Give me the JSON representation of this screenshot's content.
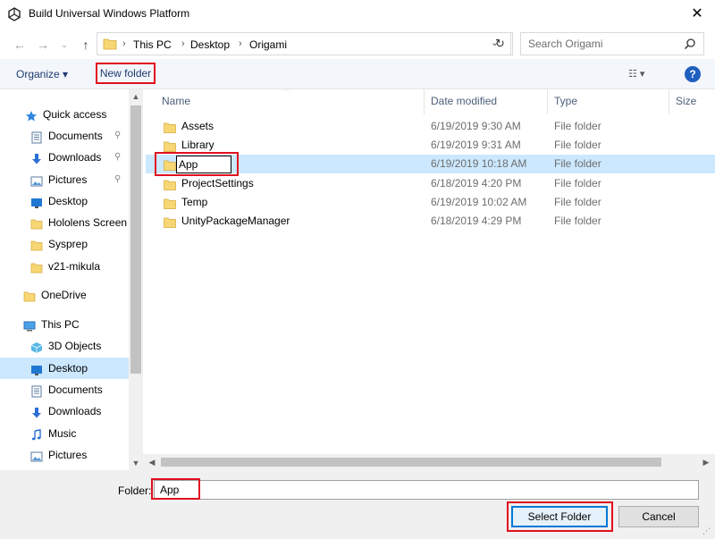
{
  "window": {
    "title": "Build Universal Windows Platform",
    "close_label": "✕"
  },
  "address": {
    "crumbs": [
      "This PC",
      "Desktop",
      "Origami"
    ],
    "separator": "›",
    "history_dropdown": "⌄",
    "refresh_label": "↻"
  },
  "search": {
    "placeholder": "Search Origami"
  },
  "toolbar": {
    "organize_label": "Organize ▾",
    "new_folder_label": "New folder",
    "view_label": "☷ ▾",
    "help_label": "?"
  },
  "nav": {
    "items": [
      {
        "label": "Quick access",
        "icon": "star-icon",
        "pinned": false
      },
      {
        "label": "Documents",
        "icon": "documents-icon",
        "pinned": true
      },
      {
        "label": "Downloads",
        "icon": "downloads-icon",
        "pinned": true
      },
      {
        "label": "Pictures",
        "icon": "pictures-icon",
        "pinned": true
      },
      {
        "label": "Desktop",
        "icon": "desktop-icon",
        "pinned": false
      },
      {
        "label": "Hololens Screen",
        "icon": "folder-icon",
        "pinned": false
      },
      {
        "label": "Sysprep",
        "icon": "folder-icon",
        "pinned": false
      },
      {
        "label": "v21-mikula",
        "icon": "folder-icon",
        "pinned": false
      },
      {
        "label": "OneDrive",
        "icon": "folder-icon",
        "pinned": false
      },
      {
        "label": "This PC",
        "icon": "computer-icon",
        "pinned": false
      },
      {
        "label": "3D Objects",
        "icon": "cube-icon",
        "pinned": false
      },
      {
        "label": "Desktop",
        "icon": "desktop-icon",
        "pinned": false,
        "selected": true
      },
      {
        "label": "Documents",
        "icon": "documents-icon",
        "pinned": false
      },
      {
        "label": "Downloads",
        "icon": "downloads-icon",
        "pinned": false
      },
      {
        "label": "Music",
        "icon": "music-icon",
        "pinned": false
      },
      {
        "label": "Pictures",
        "icon": "pictures-icon",
        "pinned": false
      }
    ],
    "pin_glyph": "📌"
  },
  "filelist": {
    "columns": [
      "Name",
      "Date modified",
      "Type",
      "Size"
    ],
    "sort_glyph": "^",
    "rows": [
      {
        "name": "Assets",
        "date": "6/19/2019 9:30 AM",
        "type": "File folder"
      },
      {
        "name": "Library",
        "date": "6/19/2019 9:31 AM",
        "type": "File folder"
      },
      {
        "name": "App",
        "date": "6/19/2019 10:18 AM",
        "type": "File folder",
        "editing": true
      },
      {
        "name": "ProjectSettings",
        "date": "6/18/2019 4:20 PM",
        "type": "File folder"
      },
      {
        "name": "Temp",
        "date": "6/19/2019 10:02 AM",
        "type": "File folder"
      },
      {
        "name": "UnityPackageManager",
        "date": "6/18/2019 4:29 PM",
        "type": "File folder"
      }
    ]
  },
  "bottom": {
    "folder_label": "Folder:",
    "folder_value": "App",
    "select_label": "Select Folder",
    "cancel_label": "Cancel"
  },
  "colors": {
    "highlight_red": "#e0101f",
    "selection_blue": "#cce8ff",
    "folder_yellow": "#f7d774",
    "accent_blue": "#0078d7"
  }
}
